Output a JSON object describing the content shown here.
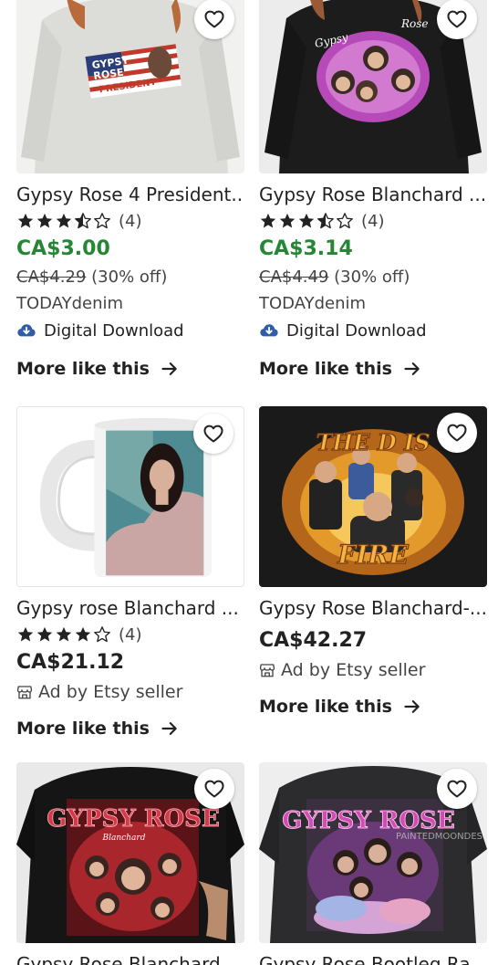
{
  "accent": {
    "sale_price": "#258635",
    "text": "#222222",
    "secondary": "#444444"
  },
  "more_label": "More like this",
  "products": [
    {
      "title": "Gypsy Rose 4 President...",
      "rating_count": "(4)",
      "rating": 3.5,
      "price": "CA$3.00",
      "original_price": "CA$4.29",
      "discount": "(30% off)",
      "shop": "TODAYdenim",
      "badge": "Digital Download",
      "image_icon": "sweatshirt-image"
    },
    {
      "title": "Gypsy Rose Blanchard ...",
      "rating_count": "(4)",
      "rating": 3.5,
      "price": "CA$3.14",
      "original_price": "CA$4.49",
      "discount": "(30% off)",
      "shop": "TODAYdenim",
      "badge": "Digital Download",
      "image_icon": "sweatshirt-image"
    },
    {
      "title": "Gypsy rose Blanchard ...",
      "rating_count": "(4)",
      "rating": 4,
      "price": "CA$21.12",
      "ad_label": "Ad by Etsy seller",
      "image_icon": "mug-image"
    },
    {
      "title": "Gypsy Rose Blanchard-...",
      "price": "CA$42.27",
      "ad_label": "Ad by Etsy seller",
      "image_icon": "poster-image"
    },
    {
      "title": "Gypsy Rose Blanchard ...",
      "image_icon": "tshirt-image"
    },
    {
      "title": "Gypsy Rose Bootleg Ra...",
      "image_icon": "tshirt-image"
    }
  ],
  "image_text": {
    "p1_banner": [
      "GYPSY",
      "ROSE",
      "PRESIDENT"
    ],
    "p2_banner": [
      "Gypsy",
      "Rose"
    ],
    "p4_top": "THE D IS",
    "p4_bottom": "FIRE",
    "p5_banner": "GYPSY ROSE",
    "p5_sub": "Blanchard",
    "p6_banner": "GYPSY ROSE",
    "p6_watermark": "PAINTEDMOONDES"
  }
}
